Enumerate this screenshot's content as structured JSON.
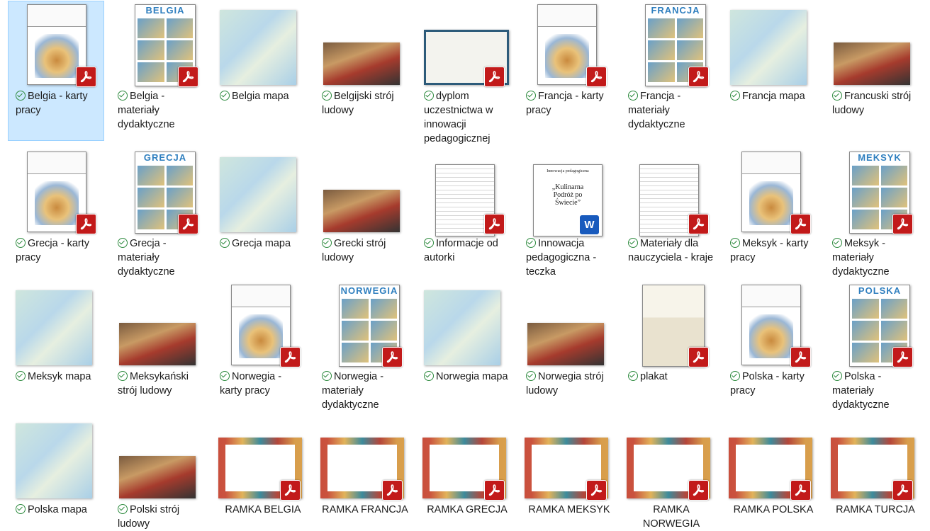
{
  "files": [
    {
      "name": "Belgia - karty pracy",
      "kind": "pdf-worksheet",
      "selected": true
    },
    {
      "name": "Belgia - materiały dydaktyczne",
      "kind": "pdf-collage",
      "thumb_title": "BELGIA"
    },
    {
      "name": "Belgia mapa",
      "kind": "map"
    },
    {
      "name": "Belgijski strój ludowy",
      "kind": "photo"
    },
    {
      "name": "dyplom uczestnictwa w innowacji pedagogicznej",
      "kind": "pdf-diploma"
    },
    {
      "name": "Francja - karty pracy",
      "kind": "pdf-worksheet"
    },
    {
      "name": "Francja - materiały dydaktyczne",
      "kind": "pdf-collage",
      "thumb_title": "FRANCJA"
    },
    {
      "name": "Francja mapa",
      "kind": "map"
    },
    {
      "name": "Francuski strój ludowy",
      "kind": "photo"
    },
    {
      "name": "Grecja - karty pracy",
      "kind": "pdf-worksheet"
    },
    {
      "name": "Grecja - materiały dydaktyczne",
      "kind": "pdf-collage",
      "thumb_title": "GRECJA"
    },
    {
      "name": "Grecja mapa",
      "kind": "map"
    },
    {
      "name": "Grecki strój ludowy",
      "kind": "photo"
    },
    {
      "name": "Informacje od autorki",
      "kind": "pdf-doc"
    },
    {
      "name": "Innowacja pedagogiczna - teczka",
      "kind": "word-doc"
    },
    {
      "name": "Materiały dla nauczyciela - kraje",
      "kind": "pdf-doc"
    },
    {
      "name": "Meksyk - karty pracy",
      "kind": "pdf-worksheet"
    },
    {
      "name": "Meksyk - materiały dydaktyczne",
      "kind": "pdf-collage",
      "thumb_title": "MEKSYK"
    },
    {
      "name": "Meksyk mapa",
      "kind": "map"
    },
    {
      "name": "Meksykański strój ludowy",
      "kind": "photo"
    },
    {
      "name": "Norwegia - karty pracy",
      "kind": "pdf-worksheet"
    },
    {
      "name": "Norwegia - materiały dydaktyczne",
      "kind": "pdf-collage",
      "thumb_title": "NORWEGIA"
    },
    {
      "name": "Norwegia mapa",
      "kind": "map"
    },
    {
      "name": "Norwegia strój ludowy",
      "kind": "photo"
    },
    {
      "name": "plakat",
      "kind": "pdf-poster"
    },
    {
      "name": "Polska - karty pracy",
      "kind": "pdf-worksheet"
    },
    {
      "name": "Polska - materiały dydaktyczne",
      "kind": "pdf-collage",
      "thumb_title": "POLSKA"
    },
    {
      "name": "Polska mapa",
      "kind": "map"
    },
    {
      "name": "Polski strój ludowy",
      "kind": "photo"
    },
    {
      "name": "RAMKA BELGIA",
      "kind": "pdf-frame"
    },
    {
      "name": "RAMKA FRANCJA",
      "kind": "pdf-frame"
    },
    {
      "name": "RAMKA GRECJA",
      "kind": "pdf-frame"
    },
    {
      "name": "RAMKA MEKSYK",
      "kind": "pdf-frame"
    },
    {
      "name": "RAMKA NORWEGIA",
      "kind": "pdf-frame"
    },
    {
      "name": "RAMKA POLSKA",
      "kind": "pdf-frame"
    },
    {
      "name": "RAMKA TURCJA",
      "kind": "pdf-frame"
    }
  ],
  "thumb_texts": {
    "word_badge": "W",
    "doc_heading": "Innowacja pedagogiczna",
    "doc_title": "„Kulinarna Podróż po Świecie”"
  },
  "colors": {
    "selection": "#cce8ff",
    "status_ok": "#2d8a3e",
    "pdf_badge": "#c21a1a",
    "word_badge": "#185abd"
  },
  "icons": {
    "status": "sync-ok-icon",
    "pdf": "pdf-icon",
    "word": "word-icon"
  }
}
